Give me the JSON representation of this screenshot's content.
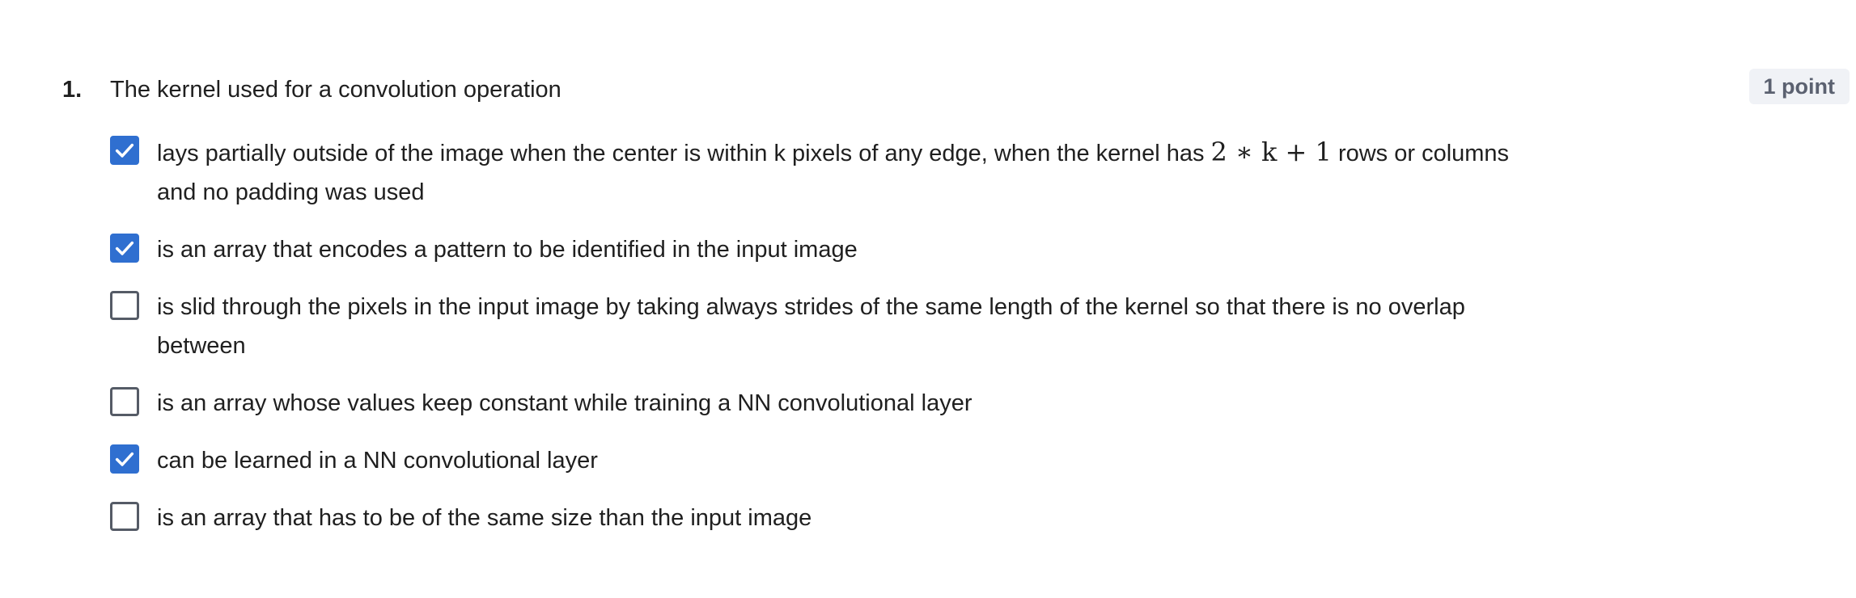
{
  "question": {
    "number": "1.",
    "text": "The kernel used for a convolution operation",
    "points": "1 point"
  },
  "options": [
    {
      "checked": true,
      "text_before": "lays partially outside of the image when the center is within k pixels of any edge, when the kernel has",
      "math": "2 ∗ k + 1",
      "text_after": "rows or columns and no padding was used"
    },
    {
      "checked": true,
      "text": "is an array that encodes a pattern to be identified in the input image"
    },
    {
      "checked": false,
      "text": "is slid through the pixels in the input image by taking always strides of the same length of the kernel so that there is no overlap between"
    },
    {
      "checked": false,
      "text": "is an array whose values keep constant while training a NN convolutional layer"
    },
    {
      "checked": true,
      "text": "can be learned in a NN convolutional layer"
    },
    {
      "checked": false,
      "text": "is an array that has to be of the same size than the input image"
    }
  ],
  "colors": {
    "checked": "#2f6fd0",
    "unchecked_border": "#555b66",
    "badge_bg": "#f0f2f6"
  }
}
